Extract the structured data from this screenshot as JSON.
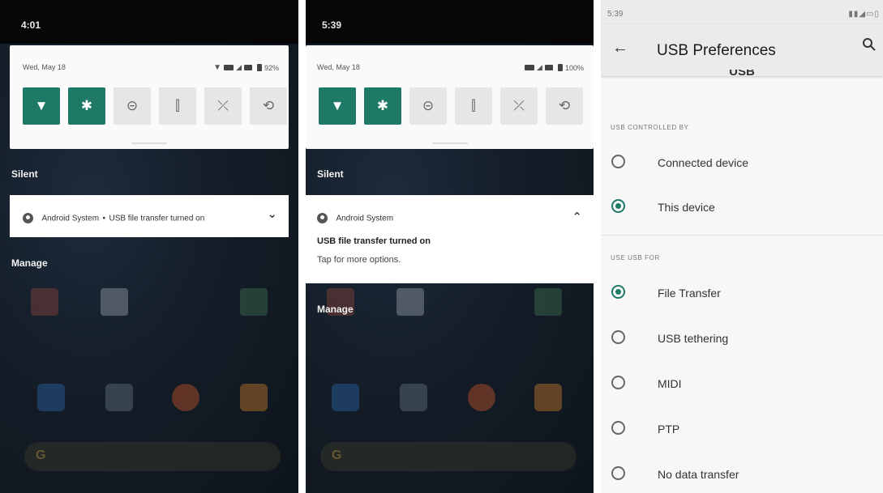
{
  "panel1": {
    "time": "4:01",
    "date": "Wed, May 18",
    "battery": "92%",
    "section_silent": "Silent",
    "notification": {
      "app": "Android System",
      "separator": "•",
      "text": "USB file transfer turned on",
      "chevron": "⌄"
    },
    "section_manage": "Manage"
  },
  "panel2": {
    "time": "5:39",
    "date": "Wed, May 18",
    "battery": "100%",
    "section_silent": "Silent",
    "notification": {
      "app": "Android System",
      "title": "USB file transfer turned on",
      "subtitle": "Tap for more options.",
      "chevron": "⌃"
    },
    "section_manage": "Manage"
  },
  "panel3": {
    "time": "5:39",
    "title": "USB Preferences",
    "subheading": "USB",
    "group1": {
      "label": "USB CONTROLLED BY",
      "options": [
        "Connected device",
        "This device"
      ],
      "selected": "This device"
    },
    "group2": {
      "label": "USE USB FOR",
      "options": [
        "File Transfer",
        "USB tethering",
        "MIDI",
        "PTP",
        "No data transfer"
      ],
      "selected": "File Transfer"
    }
  },
  "icons": {
    "back": "←",
    "wifi": "▼",
    "bluetooth": "✱",
    "dnd": "⊝",
    "flashlight": "⫿",
    "data_saver": "⤫",
    "rotate": "⟲"
  },
  "colors": {
    "accent": "#1e7a67",
    "shade": "#060606",
    "card": "#ffffff"
  }
}
